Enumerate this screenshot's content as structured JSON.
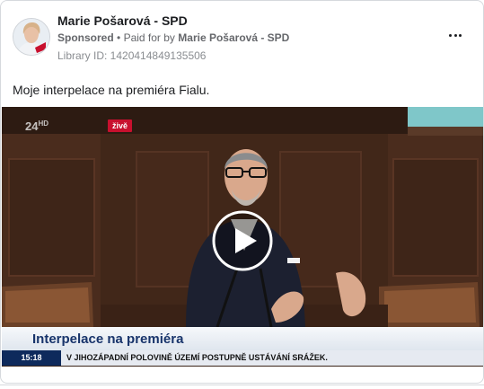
{
  "post": {
    "advertiser_name": "Marie Pošarová - SPD",
    "sponsored_label": "Sponsored",
    "separator": "•",
    "paid_for_prefix": "Paid for by",
    "paid_for_by": "Marie Pošarová - SPD",
    "library_id_text": "Library ID: 1420414849135506",
    "more_options_icon": "more-horizontal-icon",
    "body_text": "Moje interpelace na premiéra Fialu."
  },
  "video": {
    "channel_logo": "24",
    "channel_logo_suffix": "HD",
    "live_badge": "živě",
    "lower_third_title": "Interpelace na premiéra",
    "ticker_time": "15:18",
    "ticker_text": "V JIHOZÁPADNÍ POLOVINĚ ÚZEMÍ POSTUPNĚ USTÁVÁNÍ SRÁŽEK.",
    "play_icon": "play-icon"
  },
  "colors": {
    "live_badge": "#c8102e",
    "lower_third_title": "#18346b",
    "ticker_time_bg": "#0e2a5c"
  }
}
